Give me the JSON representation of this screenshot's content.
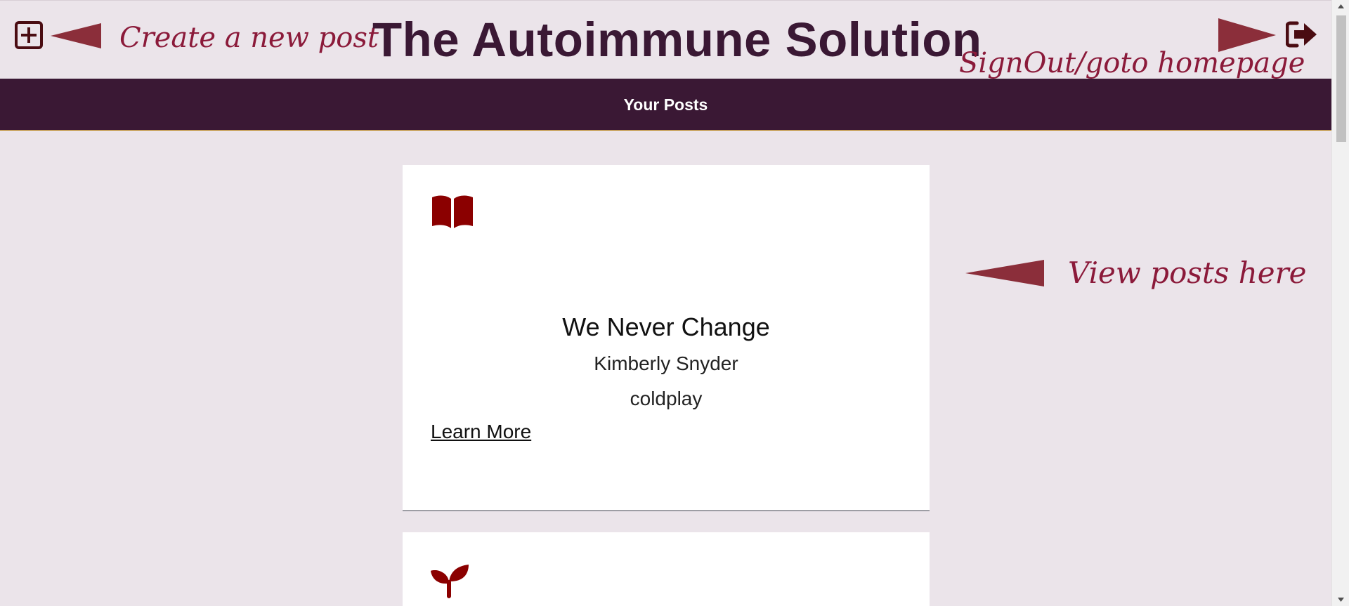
{
  "header": {
    "title": "The Autoimmune Solution",
    "new_post_icon": "plus-square-icon",
    "signout_icon": "sign-out-icon"
  },
  "annotations": {
    "create_post": "Create a new post",
    "signout": "SignOut/goto homepage",
    "view_posts": "View posts here"
  },
  "nav": {
    "your_posts": "Your Posts"
  },
  "posts": [
    {
      "icon": "book-open-icon",
      "title": "We Never Change",
      "author": "Kimberly Snyder",
      "tag": "coldplay",
      "link_label": "Learn More"
    },
    {
      "icon": "seedling-icon"
    }
  ],
  "colors": {
    "background": "#ebe4ea",
    "brand_dark": "#3a1834",
    "icon_red": "#8b0000",
    "annotation": "#8b1a3a",
    "nav_border": "#b8861f"
  }
}
